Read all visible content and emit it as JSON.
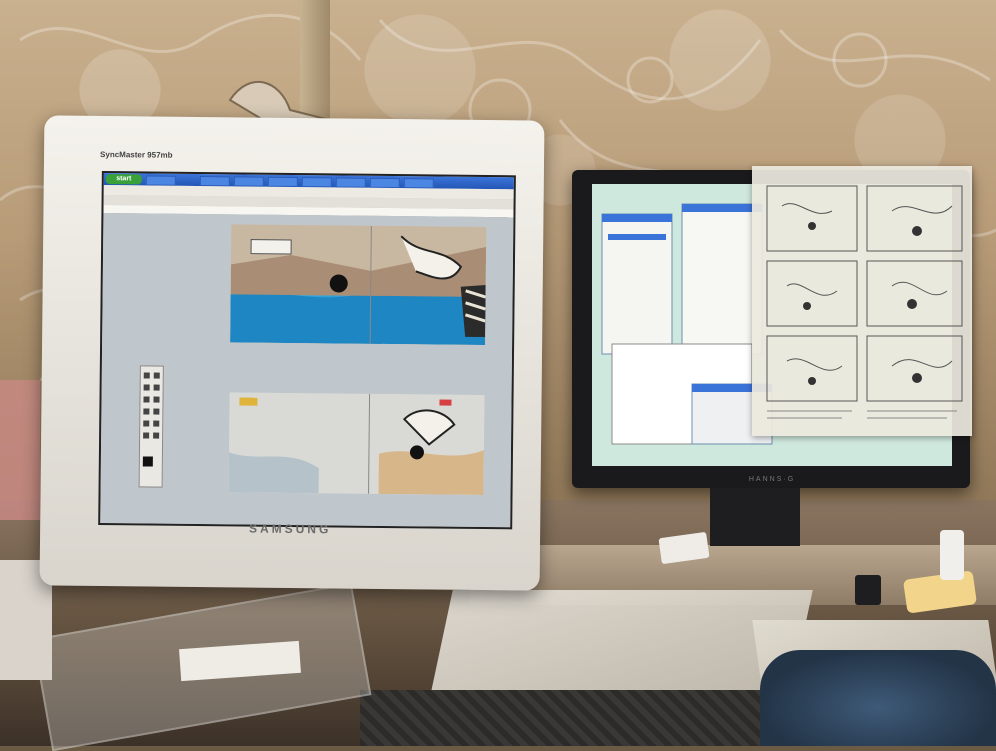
{
  "scene": {
    "description_kind": "photo",
    "colors": {
      "wallpaper": "#c9b08e",
      "taskbar": "#2356b6",
      "right_screen": "#d2e6de"
    }
  },
  "left_monitor": {
    "model_label": "SyncMaster 957mb",
    "brand": "SAMSUNG"
  },
  "left_screen": {
    "start_label": "start"
  },
  "right_monitor": {
    "brand": "HANNS·G"
  }
}
